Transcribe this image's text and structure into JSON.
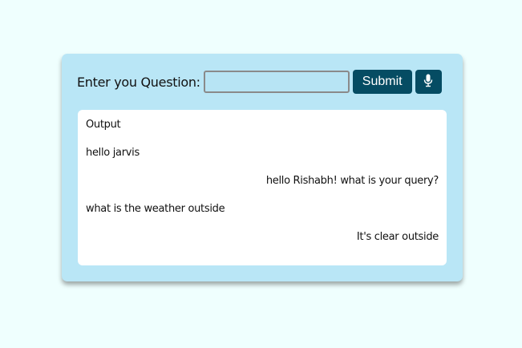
{
  "question": {
    "label": "Enter you Question:",
    "input_value": "",
    "submit_label": "Submit",
    "mic_icon": "microphone-icon"
  },
  "output": {
    "title": "Output",
    "messages": [
      {
        "role": "user",
        "text": "hello jarvis"
      },
      {
        "role": "bot",
        "text": "hello Rishabh! what is your query?"
      },
      {
        "role": "user",
        "text": "what is the weather outside"
      },
      {
        "role": "bot",
        "text": "It's clear outside"
      }
    ]
  },
  "colors": {
    "page_background": "#effffe",
    "card_background": "#b9e6f6",
    "button_background": "#054c63",
    "output_background": "#ffffff"
  }
}
